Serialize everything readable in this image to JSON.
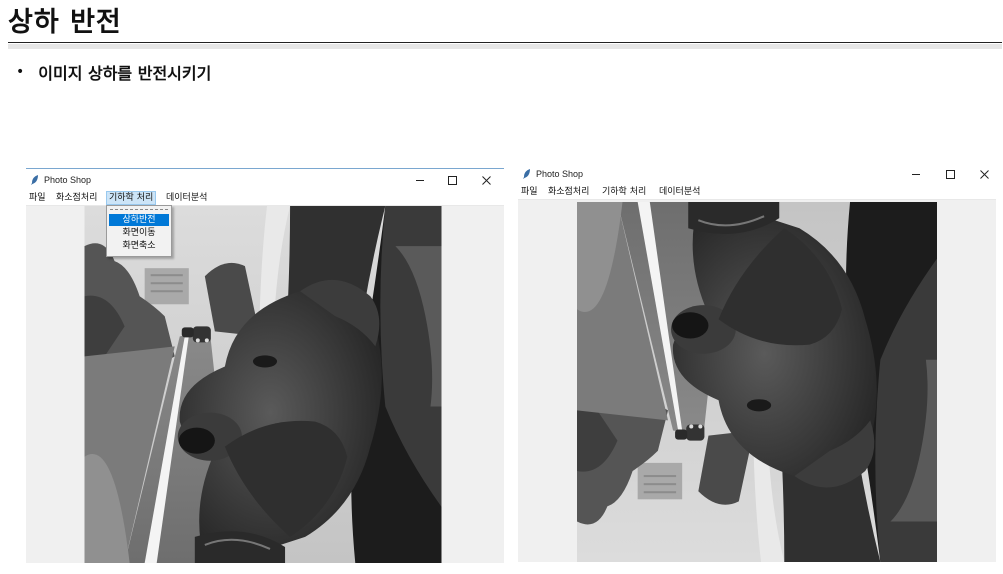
{
  "page": {
    "title": "상하 반전",
    "bullet": "이미지 상하를 반전시키기"
  },
  "windows": [
    {
      "title": "Photo Shop",
      "menu": [
        "파일",
        "화소점처리",
        "기하학 처리",
        "데이터분석"
      ],
      "active_menu": "기하학 처리",
      "dropdown": [
        "상하반전",
        "화면이동",
        "화면축소"
      ],
      "selected_item": "상하반전",
      "image_orientation": "normal"
    },
    {
      "title": "Photo Shop",
      "menu": [
        "파일",
        "화소점처리",
        "기하학 처리",
        "데이터분석"
      ],
      "image_orientation": "flipped-vertical"
    }
  ],
  "icons": {
    "app": "feather-icon",
    "minimize": "minimize-icon",
    "maximize": "maximize-icon",
    "close": "close-icon"
  },
  "colors": {
    "menu_highlight": "#cce4f7",
    "selected_item": "#0078d7",
    "client_bg": "#f0f0f0"
  }
}
